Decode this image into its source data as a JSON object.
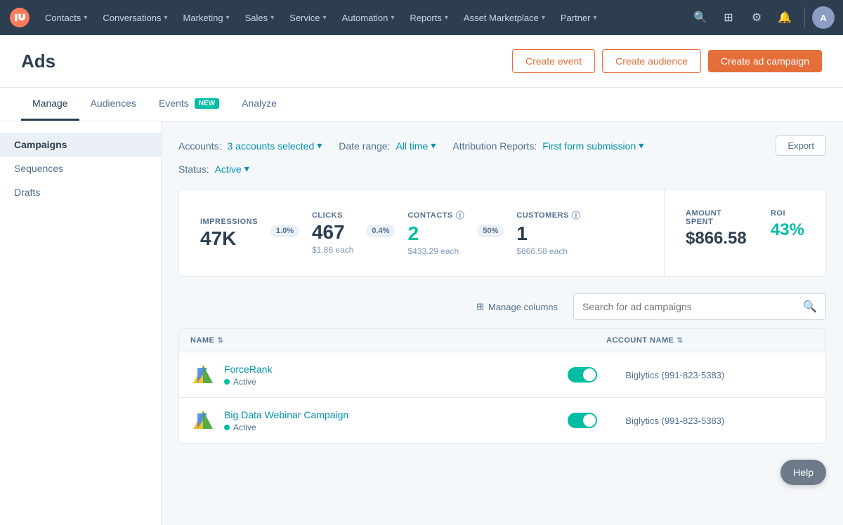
{
  "nav": {
    "items": [
      {
        "label": "Contacts",
        "id": "contacts"
      },
      {
        "label": "Conversations",
        "id": "conversations"
      },
      {
        "label": "Marketing",
        "id": "marketing"
      },
      {
        "label": "Sales",
        "id": "sales"
      },
      {
        "label": "Service",
        "id": "service"
      },
      {
        "label": "Automation",
        "id": "automation"
      },
      {
        "label": "Reports",
        "id": "reports"
      },
      {
        "label": "Asset Marketplace",
        "id": "asset-marketplace"
      },
      {
        "label": "Partner",
        "id": "partner"
      }
    ]
  },
  "page": {
    "title": "Ads",
    "buttons": {
      "create_event": "Create event",
      "create_audience": "Create audience",
      "create_campaign": "Create ad campaign"
    }
  },
  "tabs": [
    {
      "label": "Manage",
      "active": true,
      "badge": null
    },
    {
      "label": "Audiences",
      "active": false,
      "badge": null
    },
    {
      "label": "Events",
      "active": false,
      "badge": "NEW"
    },
    {
      "label": "Analyze",
      "active": false,
      "badge": null
    }
  ],
  "sidebar": {
    "items": [
      {
        "label": "Campaigns",
        "active": true
      },
      {
        "label": "Sequences",
        "active": false
      },
      {
        "label": "Drafts",
        "active": false
      }
    ]
  },
  "filters": {
    "accounts_label": "Accounts:",
    "accounts_value": "3 accounts selected",
    "date_range_label": "Date range:",
    "date_range_value": "All time",
    "attribution_label": "Attribution Reports:",
    "attribution_value": "First form submission",
    "status_label": "Status:",
    "status_value": "Active",
    "export_label": "Export"
  },
  "stats": {
    "impressions": {
      "label": "IMPRESSIONS",
      "value": "47K"
    },
    "clicks": {
      "label": "CLICKS",
      "value": "467",
      "conversion": "1.0%",
      "sub": "$1.86 each"
    },
    "contacts": {
      "label": "CONTACTS",
      "value": "2",
      "conversion": "0.4%",
      "sub": "$433.29 each"
    },
    "customers": {
      "label": "CUSTOMERS",
      "value": "1",
      "conversion": "50%",
      "sub": "$866.58 each"
    },
    "amount_spent": {
      "label": "AMOUNT SPENT",
      "value": "$866.58"
    },
    "roi": {
      "label": "ROI",
      "value": "43%"
    }
  },
  "table": {
    "manage_columns_label": "Manage columns",
    "search_placeholder": "Search for ad campaigns",
    "columns": {
      "name": "NAME",
      "account_name": "ACCOUNT NAME"
    },
    "rows": [
      {
        "name": "ForceRank",
        "status": "Active",
        "account": "Biglytics (991-823-5383)"
      },
      {
        "name": "Big Data Webinar Campaign",
        "status": "Active",
        "account": "Biglytics (991-823-5383)"
      }
    ]
  },
  "help": {
    "label": "Help"
  },
  "colors": {
    "accent_orange": "#e66e3a",
    "accent_teal": "#00bda5",
    "link_blue": "#0091ae"
  }
}
